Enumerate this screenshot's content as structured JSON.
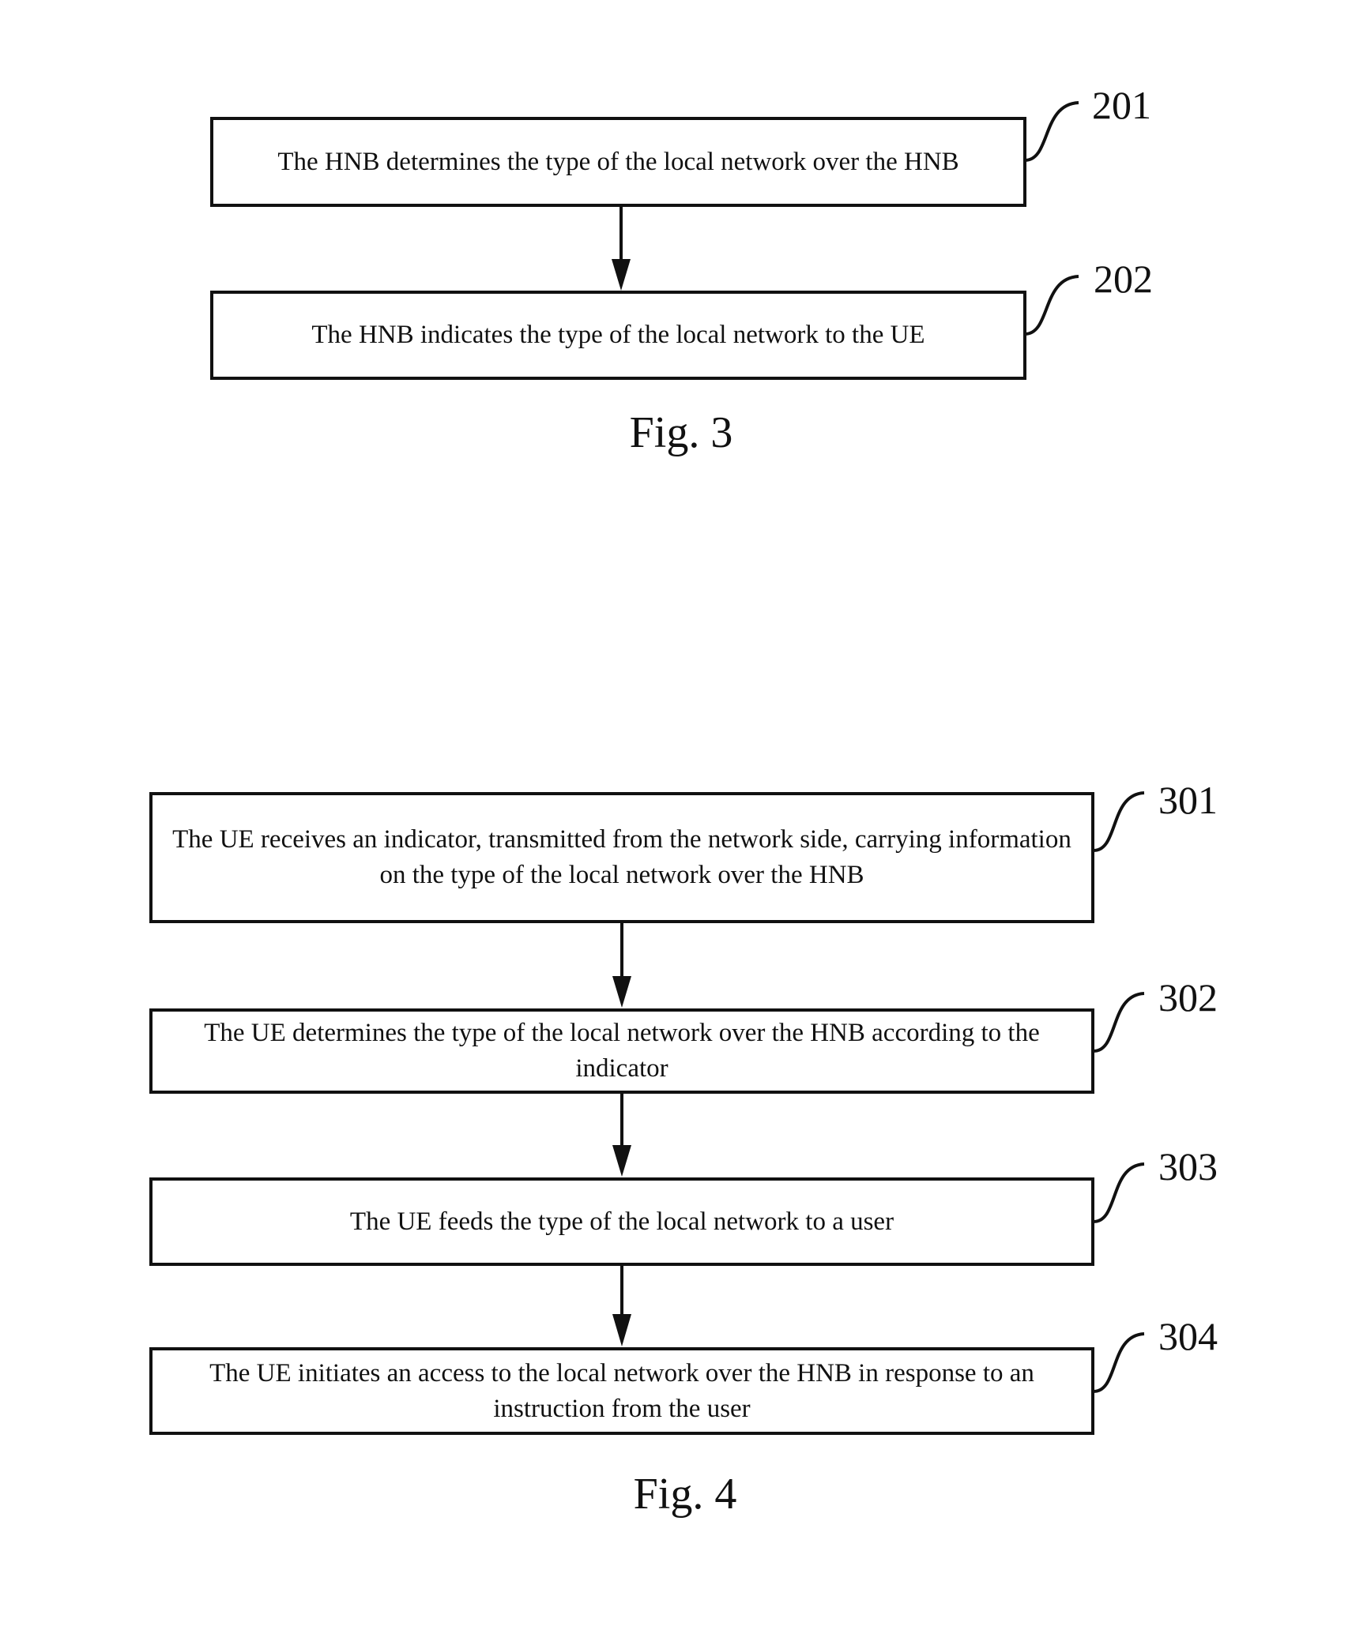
{
  "figures": [
    {
      "caption": "Fig. 3",
      "steps": [
        {
          "ref": "201",
          "text": "The HNB determines the type of the local network over the HNB"
        },
        {
          "ref": "202",
          "text": "The HNB indicates the type of the local network to the UE"
        }
      ]
    },
    {
      "caption": "Fig. 4",
      "steps": [
        {
          "ref": "301",
          "text": "The UE receives an indicator, transmitted from the network side, carrying information on the type of the local network over the HNB"
        },
        {
          "ref": "302",
          "text": "The UE determines the type of the local network over the HNB according to the indicator"
        },
        {
          "ref": "303",
          "text": "The UE feeds the type of the local network to a user"
        },
        {
          "ref": "304",
          "text": "The UE initiates an access to the local network over the HNB in response to an instruction from the user"
        }
      ]
    }
  ]
}
